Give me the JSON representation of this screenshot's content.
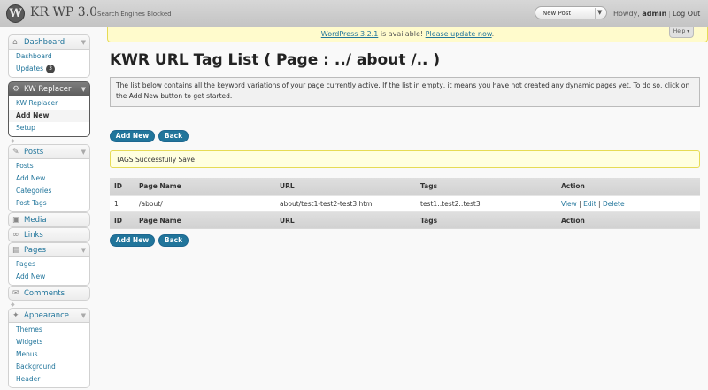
{
  "header": {
    "site_title": "KR WP 3.0",
    "site_status": "Search Engines Blocked",
    "favorite_action": "New Post",
    "howdy": "Howdy,",
    "username": "admin",
    "logout": "Log Out"
  },
  "notice_bar": {
    "version_link": "WordPress 3.2.1",
    "available_text": " is available! ",
    "update_link": "Please update now",
    "help": "Help"
  },
  "menu": {
    "dashboard": "Dashboard",
    "updates": "Updates",
    "updates_count": "3",
    "kw_replacer": "KW Replacer",
    "kw_items": [
      "KW Replacer",
      "Add New",
      "Setup"
    ],
    "posts": "Posts",
    "posts_items": [
      "Posts",
      "Add New",
      "Categories",
      "Post Tags"
    ],
    "media": "Media",
    "links": "Links",
    "pages": "Pages",
    "pages_items": [
      "Pages",
      "Add New"
    ],
    "comments": "Comments",
    "appearance": "Appearance",
    "appearance_items": [
      "Themes",
      "Widgets",
      "Menus",
      "Background",
      "Header"
    ]
  },
  "main": {
    "title": "KWR URL Tag List ( Page : ../ about /.. )",
    "intro": "The list below contains all the keyword variations of your page currently active. If the list in empty, it means you have not created any dynamic pages yet. To do so, click on the Add New button to get started.",
    "add_new": "Add New",
    "back": "Back",
    "notice": "TAGS Successfully Save!"
  },
  "table": {
    "headers": [
      "ID",
      "Page Name",
      "URL",
      "Tags",
      "Action"
    ],
    "rows": [
      {
        "id": "1",
        "page_name": "/about/",
        "url": "about/test1-test2-test3.html",
        "tags": "test1::test2::test3",
        "view": "View",
        "edit": "Edit",
        "delete": "Delete"
      }
    ]
  }
}
